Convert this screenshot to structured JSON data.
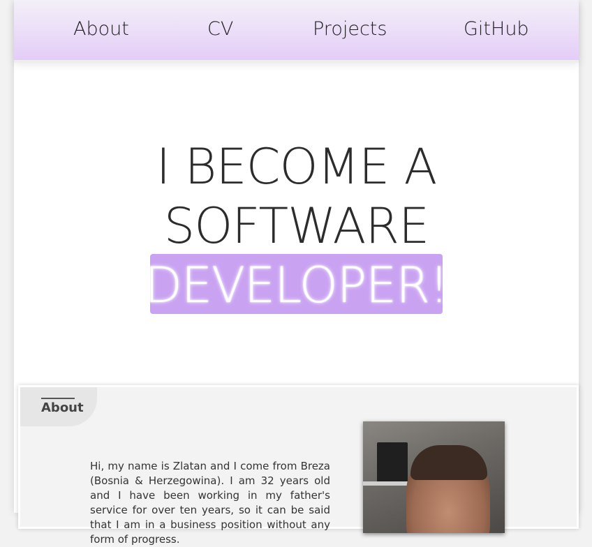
{
  "nav": {
    "items": [
      {
        "label": "About"
      },
      {
        "label": "CV"
      },
      {
        "label": "Projects"
      },
      {
        "label": "GitHub"
      }
    ]
  },
  "hero": {
    "line1": "I BECOME A",
    "line2": "SOFTWARE",
    "line3": "DEVELOPER!",
    "highlight_color": "#c9a2f2"
  },
  "about": {
    "title": "About",
    "text": "Hi, my name is Zlatan and I come from Breza (Bosnia & Herzegowina). I am 32 years old and I have been working in my father's service for over ten years, so it can be said that I am in a business position without any form of progress."
  },
  "colors": {
    "nav_top": "#f3f0f8",
    "nav_bottom": "#e4cdf8",
    "text": "#2c2c2c"
  }
}
